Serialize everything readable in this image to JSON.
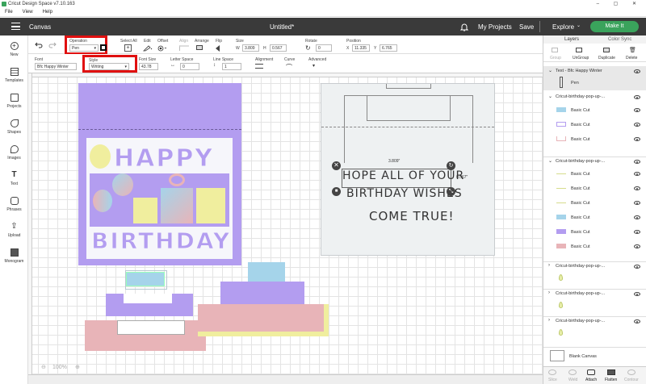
{
  "titlebar": {
    "title": "Cricut Design Space  v7.10.163",
    "controls": "‒ ▢ ✕"
  },
  "menubar": {
    "items": [
      "File",
      "View",
      "Help"
    ]
  },
  "header": {
    "section": "Canvas",
    "doc_title": "Untitled*",
    "my_projects": "My Projects",
    "save": "Save",
    "explore": "Explore",
    "make_it": "Make It"
  },
  "toolbar": {
    "operation_label": "Operation",
    "operation_value": "Pen",
    "select_all": "Select All",
    "edit": "Edit",
    "offset": "Offset",
    "align": "Align",
    "arrange": "Arrange",
    "flip": "Flip",
    "size_label": "Size",
    "w_label": "W",
    "w_value": "3.809",
    "h_label": "H",
    "h_value": "0.567",
    "rotate_label": "Rotate",
    "rotate_value": "0",
    "position_label": "Position",
    "x_label": "X",
    "x_value": "11.335",
    "y_label": "Y",
    "y_value": "6.765"
  },
  "toolbar2": {
    "font_label": "Font",
    "font_value": "Bfc Happy Winter",
    "style_label": "Style",
    "style_value": "Writing",
    "font_size_label": "Font Size",
    "font_size_value": "43.78",
    "letter_space_label": "Letter Space",
    "letter_space_value": "0",
    "line_space_label": "Line Space",
    "line_space_value": "1",
    "alignment_label": "Alignment",
    "curve_label": "Curve",
    "advanced_label": "Advanced"
  },
  "leftnav": {
    "items": [
      "New",
      "Templates",
      "Projects",
      "Shapes",
      "Images",
      "Text",
      "Phrases",
      "Upload",
      "Monogram"
    ]
  },
  "canvas": {
    "card_word1": "HAPPY",
    "card_word2": "BIRTHDAY",
    "text_lines": [
      "HOPE ALL OF YOUR",
      "BIRTHDAY WISHES",
      "COME TRUE!"
    ],
    "width_readout": "3.809\"",
    "height_readout": "0.567\"",
    "zoom": "100%"
  },
  "layers_panel": {
    "tab_layers": "Layers",
    "tab_color_sync": "Color Sync",
    "actions": [
      "Group",
      "UnGroup",
      "Duplicate",
      "Delete"
    ],
    "selected_group": "Text - Bfc Happy Winter",
    "selected_child": "Pen",
    "groups": [
      {
        "name": "Cricut-birthday-pop-up-...",
        "children": [
          "Basic Cut",
          "Basic Cut",
          "Basic Cut"
        ]
      },
      {
        "name": "Cricut-birthday-pop-up-...",
        "children": [
          "Basic Cut",
          "Basic Cut",
          "Basic Cut",
          "Basic Cut",
          "Basic Cut",
          "Basic Cut"
        ]
      },
      {
        "name": "Cricut-birthday-pop-up-...",
        "children": []
      },
      {
        "name": "Cricut-birthday-pop-up-...",
        "children": []
      },
      {
        "name": "Cricut-birthday-pop-up-...",
        "children": []
      }
    ],
    "blank_canvas": "Blank Canvas",
    "bottom_actions": [
      "Slice",
      "Weld",
      "Attach",
      "Flatten",
      "Contour"
    ]
  },
  "colors": {
    "header": "#3a3a3a",
    "make_it": "#3aa35c",
    "highlight": "#e01010",
    "purple": "#b39df0",
    "pink": "#e8b4b8",
    "blue": "#a5d4ea",
    "yellow": "#f0ee9e"
  }
}
